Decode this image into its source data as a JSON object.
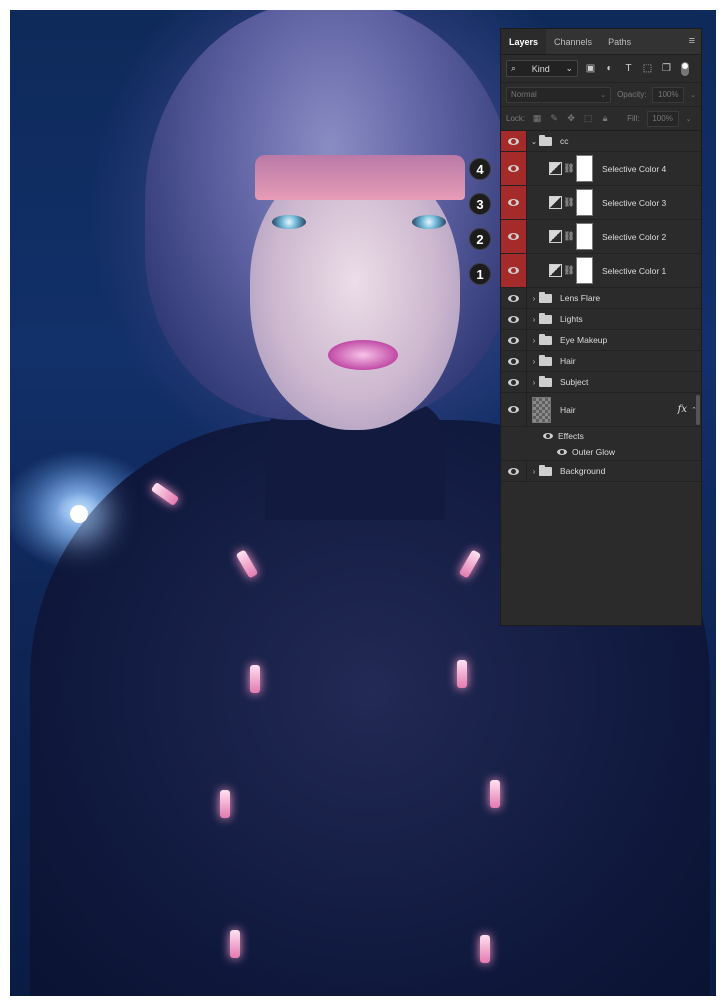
{
  "panel": {
    "tabs": [
      {
        "label": "Layers",
        "active": true
      },
      {
        "label": "Channels",
        "active": false
      },
      {
        "label": "Paths",
        "active": false
      }
    ],
    "filter": {
      "kind_label": "Kind"
    },
    "blend": {
      "mode": "Normal",
      "opacity_label": "Opacity:",
      "opacity_value": "100%"
    },
    "lock": {
      "label": "Lock:",
      "fill_label": "Fill:",
      "fill_value": "100%"
    },
    "layers": [
      {
        "name": "cc",
        "kind": "group-open",
        "highlighted": true
      },
      {
        "name": "Selective Color 4",
        "kind": "adjustment",
        "highlighted": true
      },
      {
        "name": "Selective Color 3",
        "kind": "adjustment",
        "highlighted": true
      },
      {
        "name": "Selective Color 2",
        "kind": "adjustment",
        "highlighted": true
      },
      {
        "name": "Selective Color 1",
        "kind": "adjustment",
        "highlighted": true
      },
      {
        "name": "Lens Flare",
        "kind": "group"
      },
      {
        "name": "Lights",
        "kind": "group"
      },
      {
        "name": "Eye Makeup",
        "kind": "group"
      },
      {
        "name": "Hair",
        "kind": "group"
      },
      {
        "name": "Subject",
        "kind": "group"
      },
      {
        "name": "Hair",
        "kind": "pixel",
        "fx": "fx"
      },
      {
        "name": "Background",
        "kind": "group"
      }
    ],
    "effects": {
      "label": "Effects",
      "items": [
        "Outer Glow"
      ]
    },
    "accent_color": "#a52a2a"
  },
  "callouts": [
    "4",
    "3",
    "2",
    "1"
  ]
}
